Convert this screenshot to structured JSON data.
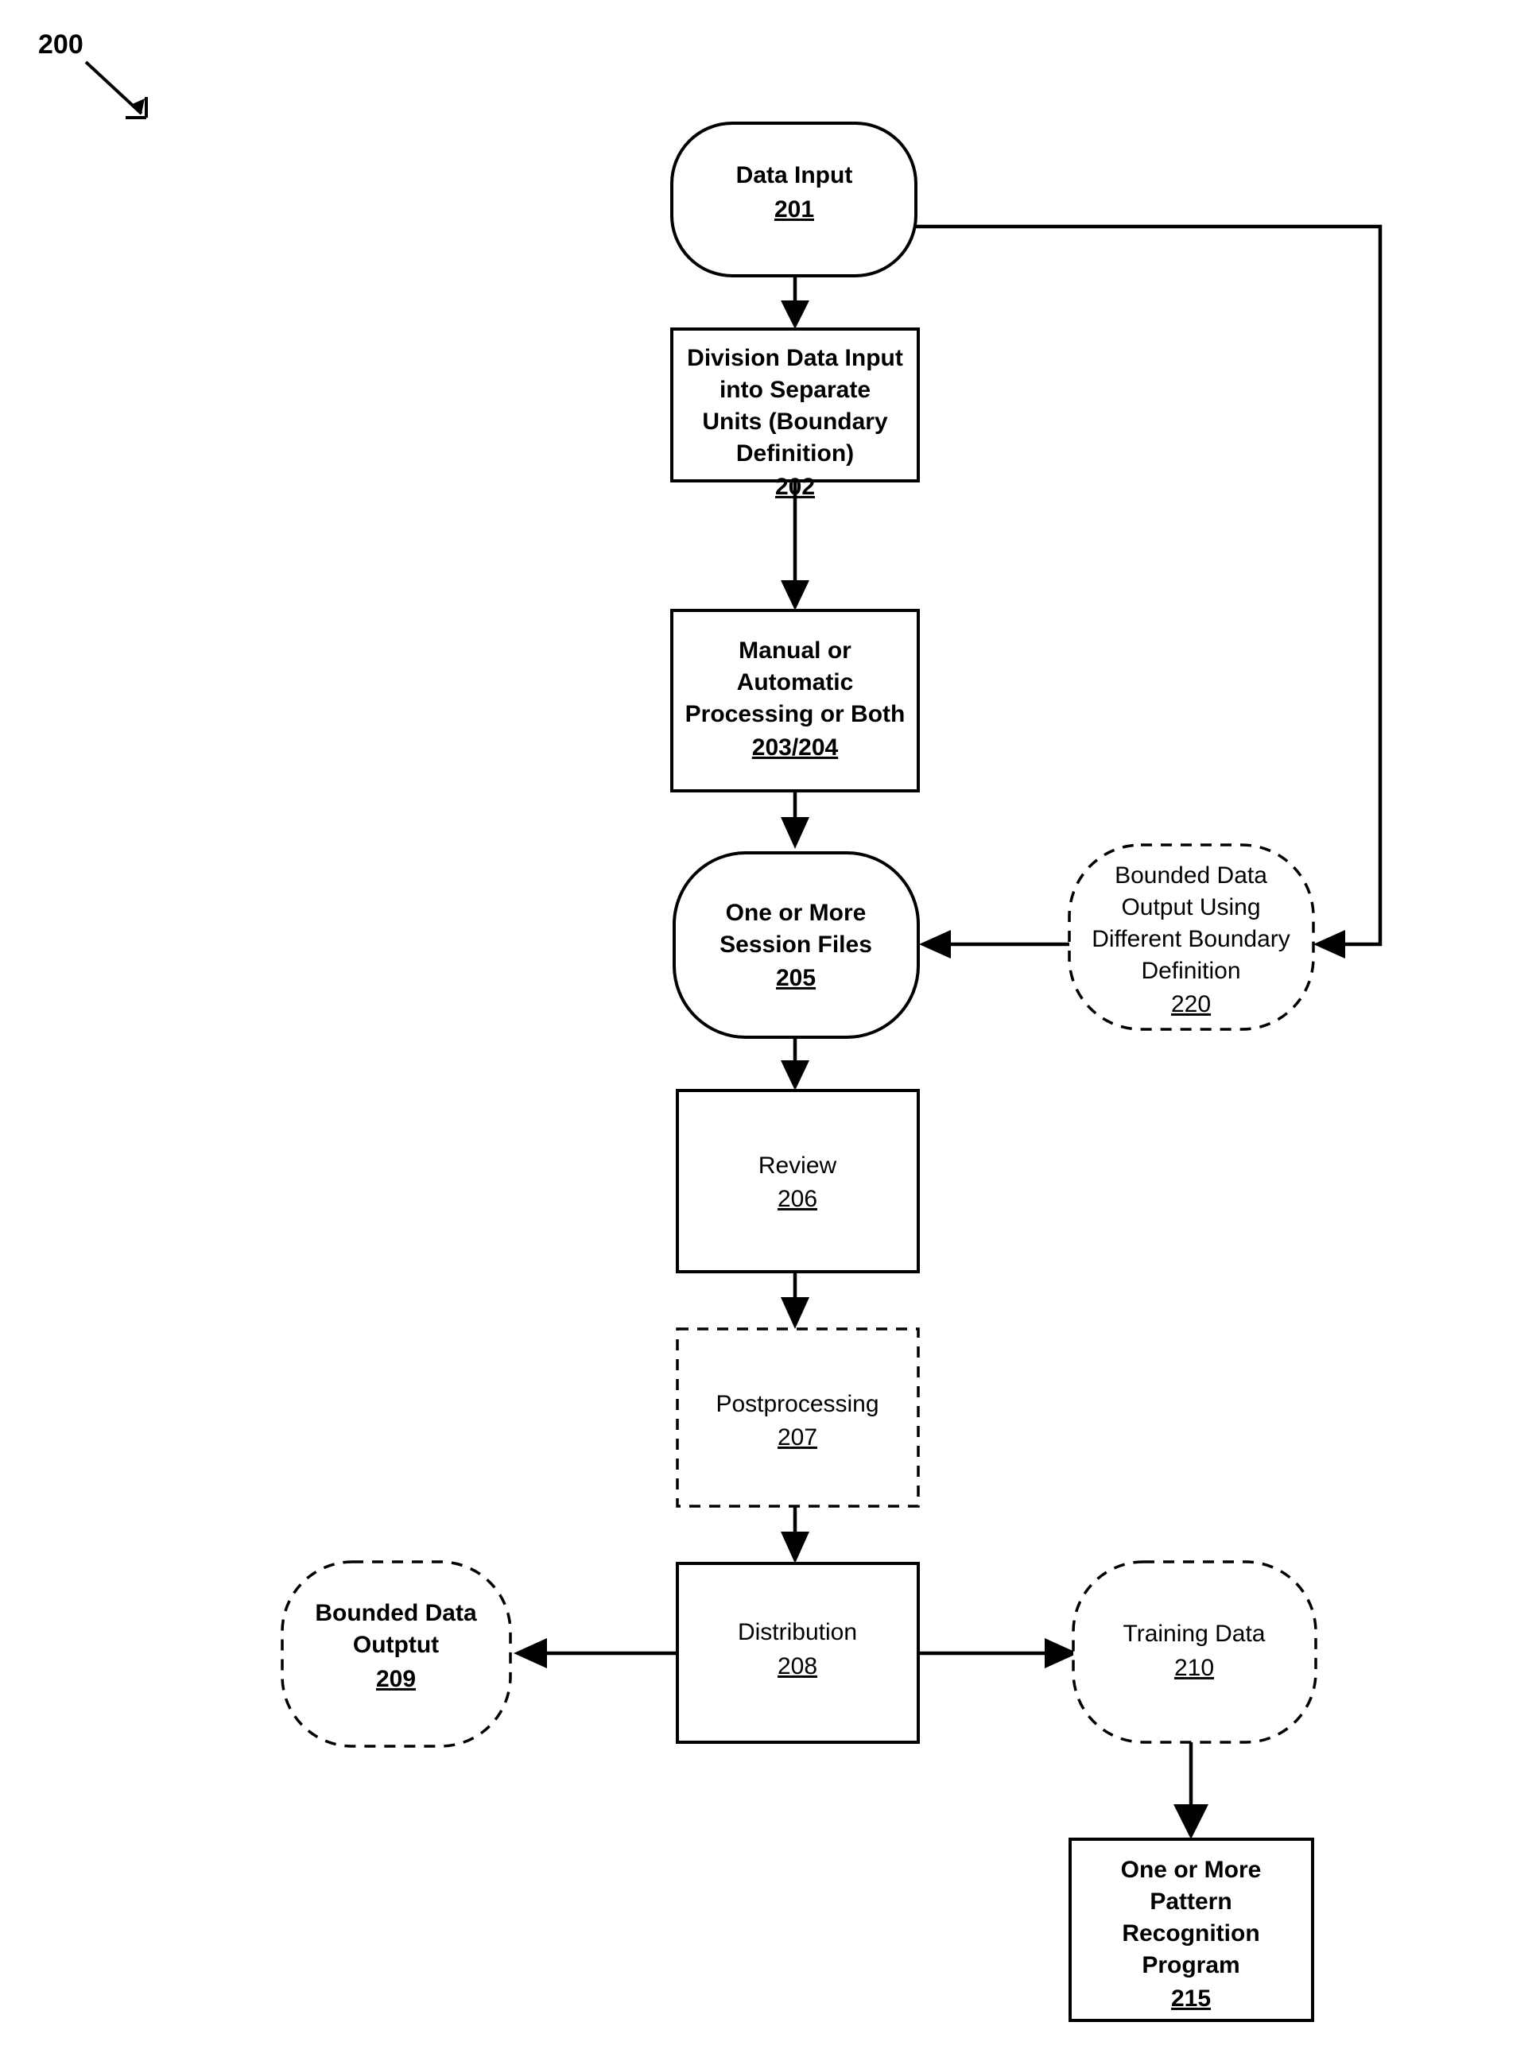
{
  "figure": {
    "label": "200",
    "leader_arrow": "diagonal-arrow-down-right"
  },
  "nodes": {
    "n201": {
      "id": "201",
      "shape": "rounded-terminator",
      "style": "solid",
      "lines": [
        "Data Input"
      ],
      "ref": "201"
    },
    "n202": {
      "id": "202",
      "shape": "rectangle",
      "style": "solid",
      "lines": [
        "Division Data Input",
        "into Separate",
        "Units (Boundary",
        "Definition)"
      ],
      "ref": "202"
    },
    "n203_204": {
      "id": "203/204",
      "shape": "rectangle",
      "style": "solid",
      "lines": [
        "Manual or",
        "Automatic",
        "Processing or Both"
      ],
      "ref": "203/204"
    },
    "n205": {
      "id": "205",
      "shape": "rounded-terminator",
      "style": "solid",
      "lines": [
        "One or More",
        "Session Files"
      ],
      "ref": "205"
    },
    "n220": {
      "id": "220",
      "shape": "rounded-terminator",
      "style": "dashed",
      "lines": [
        "Bounded Data",
        "Output Using",
        "Different Boundary",
        "Definition"
      ],
      "ref": "220"
    },
    "n206": {
      "id": "206",
      "shape": "rectangle",
      "style": "solid",
      "lines": [
        "Review"
      ],
      "ref": "206"
    },
    "n207": {
      "id": "207",
      "shape": "rectangle",
      "style": "dashed",
      "lines": [
        "Postprocessing"
      ],
      "ref": "207"
    },
    "n208": {
      "id": "208",
      "shape": "rectangle",
      "style": "solid",
      "lines": [
        "Distribution"
      ],
      "ref": "208"
    },
    "n209": {
      "id": "209",
      "shape": "rounded-terminator",
      "style": "dashed",
      "lines": [
        "Bounded Data",
        "Outptut"
      ],
      "ref": "209"
    },
    "n210": {
      "id": "210",
      "shape": "rounded-terminator",
      "style": "dashed",
      "lines": [
        "Training Data"
      ],
      "ref": "210"
    },
    "n215": {
      "id": "215",
      "shape": "rectangle",
      "style": "solid",
      "lines": [
        "One or More",
        "Pattern",
        "Recognition",
        "Program"
      ],
      "ref": "215"
    }
  },
  "edges": [
    {
      "from": "201",
      "to": "202",
      "kind": "vertical-arrow"
    },
    {
      "from": "202",
      "to": "203/204",
      "kind": "vertical-arrow"
    },
    {
      "from": "203/204",
      "to": "205",
      "kind": "vertical-arrow"
    },
    {
      "from": "201",
      "to": "220",
      "kind": "right-down-left-arrow"
    },
    {
      "from": "220",
      "to": "205",
      "kind": "horizontal-left-arrow"
    },
    {
      "from": "205",
      "to": "206",
      "kind": "vertical-arrow"
    },
    {
      "from": "206",
      "to": "207",
      "kind": "vertical-arrow"
    },
    {
      "from": "207",
      "to": "208",
      "kind": "vertical-arrow"
    },
    {
      "from": "208",
      "to": "209",
      "kind": "horizontal-left-arrow"
    },
    {
      "from": "208",
      "to": "210",
      "kind": "horizontal-right-arrow"
    },
    {
      "from": "210",
      "to": "215",
      "kind": "vertical-arrow"
    }
  ],
  "colors": {
    "stroke": "#000000",
    "background": "#ffffff"
  }
}
